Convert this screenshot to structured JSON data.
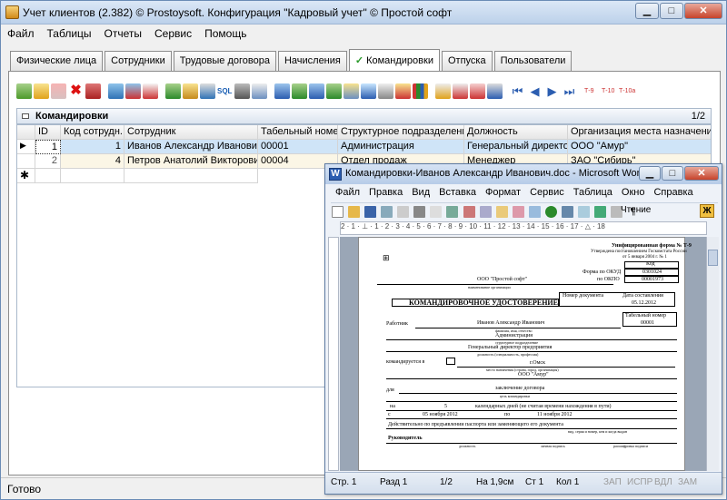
{
  "window": {
    "title": "Учет клиентов (2.382) © Prostoysoft. Конфигурация \"Кадровый учет\" © Простой софт"
  },
  "menu": [
    "Файл",
    "Таблицы",
    "Отчеты",
    "Сервис",
    "Помощь"
  ],
  "tabs": [
    "Физические лица",
    "Сотрудники",
    "Трудовые договора",
    "Начисления",
    "Командировки",
    "Отпуска",
    "Пользователи"
  ],
  "active_tab": "Командировки",
  "grid": {
    "title": "Командировки",
    "page": "1/2",
    "columns": [
      "ID",
      "Код сотрудн...",
      "Сотрудник",
      "Табельный номер",
      "Структурное подразделение",
      "Должность",
      "Организация места назначения"
    ],
    "rows": [
      {
        "id": "1",
        "code": "1",
        "employee": "Иванов Александр  Иванович",
        "tab_num": "00001",
        "dept": "Администрация",
        "position": "Генеральный директор",
        "org": "ООО \"Амур\""
      },
      {
        "id": "2",
        "code": "4",
        "employee": "Петров Анатолий Викторович",
        "tab_num": "00004",
        "dept": "Отдел продаж",
        "position": "Менеджер",
        "org": "ЗАО \"Сибирь\""
      }
    ]
  },
  "status": "Готово",
  "word": {
    "title": "Командировки-Иванов Александр  Иванович.doc - Microsoft Word",
    "menu": [
      "Файл",
      "Правка",
      "Вид",
      "Вставка",
      "Формат",
      "Сервис",
      "Таблица",
      "Окно",
      "Справка"
    ],
    "reading": "Чтение",
    "ruler": "2 · 1 · ⊥ · 1 · 2 · 3 · 4 · 5 · 6 · 7 · 8 · 9 · 10 · 11 · 12 · 13 · 14 · 15 · 16 · 17 · △ · 18",
    "status": {
      "page": "Стр. 1",
      "section": "Разд 1",
      "pages": "1/2",
      "at": "На 1,9см",
      "line": "Ст 1",
      "col": "Кол 1",
      "rec": "ЗАП",
      "trk": "ИСПР",
      "ext": "ВДЛ",
      "ovr": "ЗАМ"
    },
    "doc": {
      "form_header": "Унифицированная форма № Т-9",
      "form_sub": "Утверждена постановлением Госкомстата России",
      "form_date": "от 5 января 2004 г. № 1",
      "code_label": "Код",
      "okud_label": "Форма по ОКУД",
      "okud": "0301024",
      "okpo_label": "по ОКПО",
      "okpo": "00001973",
      "org": "ООО \"Простой софт\"",
      "org_sub": "наименование организации",
      "doc_num_label": "Номер документа",
      "doc_date_label": "Дата составления",
      "doc_date": "05.12.2012",
      "title": "КОМАНДИРОВОЧНОЕ УДОСТОВЕРЕНИЕ",
      "tab_label": "Табельный номер",
      "tab_value": "00001",
      "worker_label": "Работник",
      "worker": "Иванов Александр  Иванович",
      "worker_sub": "фамилия, имя, отчество",
      "dept": "Администрация",
      "dept_sub": "структурное подразделение",
      "position": "Генеральный директор предприятия",
      "position_sub": "должность (специальность, профессия)",
      "sent_label": "командируется в",
      "city": "г.Омск",
      "city_sub": "место назначения (страна, город, организация)",
      "dest_org": "ООО \"Амур\"",
      "for_label": "для",
      "purpose": "заключение договора",
      "purpose_sub": "цель командировки",
      "on_label": "на",
      "days": "5",
      "days_text": "календарных дней    (не считая времени нахождения в пути)",
      "from_label": "с",
      "from_date": "05 ноября 2012",
      "to_label": "по",
      "to_date": "11 ноября 2012",
      "passport": "Действительно по предъявлении паспорта или заменяющего его документа",
      "passport_sub": "вид, серия и номер, кем и когда выдан",
      "head": "Руководитель",
      "head_cols": [
        "должность",
        "личная подпись",
        "расшифровка подписи"
      ]
    }
  }
}
